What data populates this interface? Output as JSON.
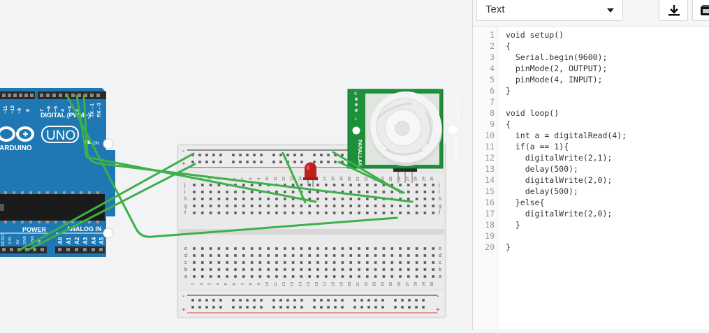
{
  "code_panel": {
    "mode_select_value": "Text",
    "download_icon": "download-icon",
    "upload_icon": "component-stack-icon",
    "lines": [
      {
        "n": "1",
        "text": "void setup()"
      },
      {
        "n": "2",
        "text": "{"
      },
      {
        "n": "3",
        "text": "  Serial.begin(9600);"
      },
      {
        "n": "4",
        "text": "  pinMode(2, OUTPUT);"
      },
      {
        "n": "5",
        "text": "  pinMode(4, INPUT);"
      },
      {
        "n": "6",
        "text": "}"
      },
      {
        "n": "7",
        "text": ""
      },
      {
        "n": "8",
        "text": "void loop()"
      },
      {
        "n": "9",
        "text": "{"
      },
      {
        "n": "10",
        "text": "  int a = digitalRead(4);"
      },
      {
        "n": "11",
        "text": "  if(a == 1){"
      },
      {
        "n": "12",
        "text": "    digitalWrite(2,1);"
      },
      {
        "n": "13",
        "text": "    delay(500);"
      },
      {
        "n": "14",
        "text": "    digitalWrite(2,0);"
      },
      {
        "n": "15",
        "text": "    delay(500);"
      },
      {
        "n": "16",
        "text": "  }else{"
      },
      {
        "n": "17",
        "text": "    digitalWrite(2,0);"
      },
      {
        "n": "18",
        "text": "  }"
      },
      {
        "n": "19",
        "text": ""
      },
      {
        "n": "20",
        "text": "}"
      }
    ]
  },
  "arduino": {
    "brand": "ARDUINO",
    "model": "UNO",
    "digital_label": "DIGITAL (PWM~)",
    "pin_labels": [
      "~11",
      "~10",
      "~9",
      "8",
      "7",
      "~6",
      "~5",
      "4",
      "~3",
      "2",
      "TX→1",
      "RX←0"
    ],
    "on_label": "ON",
    "power_label": "POWER",
    "analog_label": "ANALOG IN",
    "power_pins": [
      "RESET",
      "3.3V",
      "5V",
      "GND",
      "GND",
      "Vin"
    ],
    "analog_pins": [
      "A0",
      "A1",
      "A2",
      "A3",
      "A4",
      "A5"
    ]
  },
  "breadboard": {
    "row_letters_top": [
      "j",
      "i",
      "h",
      "g",
      "f"
    ],
    "row_letters_bottom": [
      "e",
      "d",
      "c",
      "b",
      "a"
    ],
    "columns": [
      "1",
      "2",
      "3",
      "4",
      "5",
      "6",
      "7",
      "8",
      "9",
      "10",
      "11",
      "12",
      "13",
      "14",
      "15",
      "16",
      "17",
      "18",
      "19",
      "20",
      "21",
      "22",
      "23",
      "24",
      "25",
      "26",
      "27",
      "28",
      "29",
      "30"
    ],
    "rail_minus": "-",
    "rail_plus": "+"
  },
  "pir_sensor": {
    "brand": "PARALLAX",
    "part_number": "555-28027",
    "side_text": "PIR Sensor Rev B",
    "pin_letters": [
      "S",
      "+",
      "-",
      "L"
    ]
  },
  "colors": {
    "wire": "#3cb04a",
    "arduino_board": "#1f78b4",
    "pir_board": "#1e8f3a",
    "led": "#c0201c",
    "breadboard": "#e6e6e6"
  }
}
